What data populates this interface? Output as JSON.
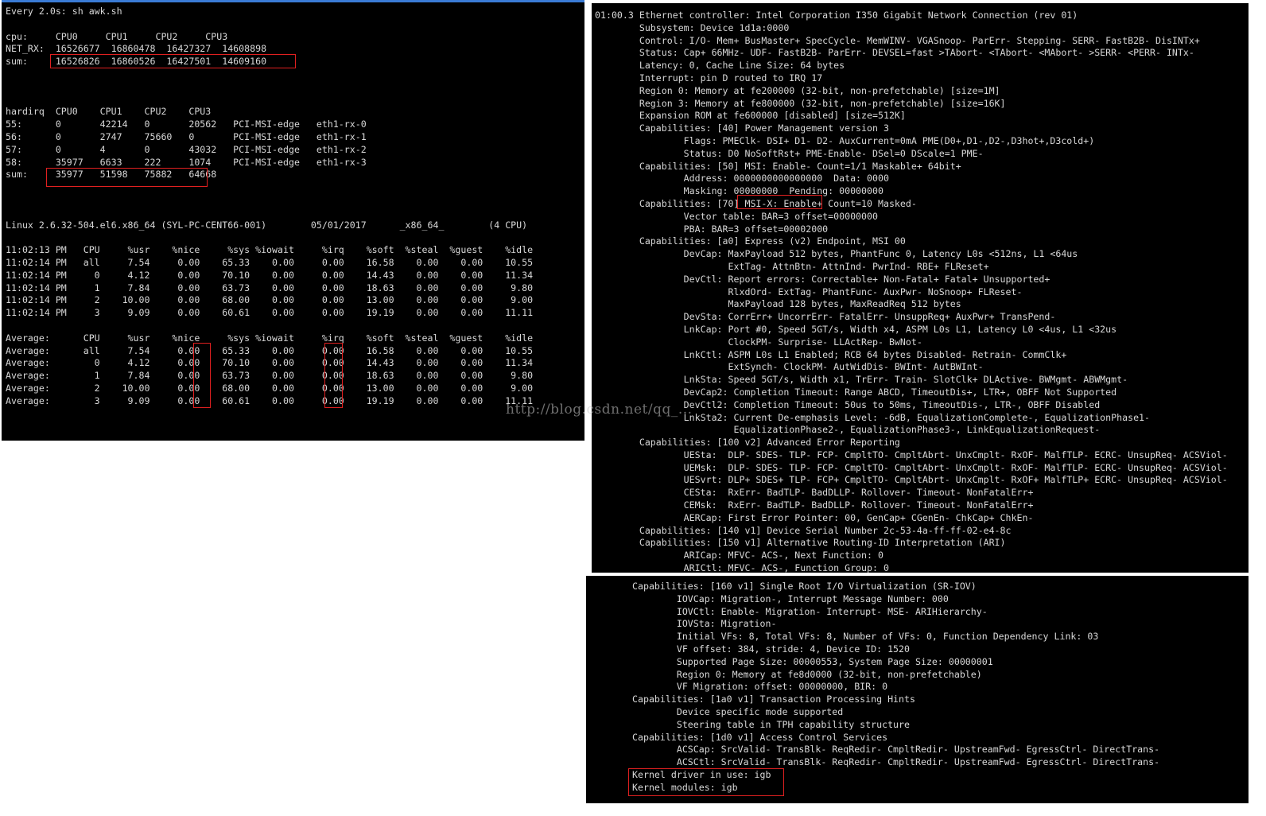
{
  "terminal_left": {
    "lines": [
      "Every 2.0s: sh awk.sh",
      "",
      "cpu:     CPU0     CPU1     CPU2     CPU3",
      "NET_RX:  16526677  16860478  16427327  14608898",
      "sum:     16526826  16860526  16427501  14609160",
      "",
      "",
      "",
      "hardirq  CPU0    CPU1    CPU2    CPU3",
      "55:      0       42214   0       20562   PCI-MSI-edge   eth1-rx-0",
      "56:      0       2747    75660   0       PCI-MSI-edge   eth1-rx-1",
      "57:      0       4       0       43032   PCI-MSI-edge   eth1-rx-2",
      "58:      35977   6633    222     1074    PCI-MSI-edge   eth1-rx-3",
      "sum:     35977   51598   75882   64668",
      "",
      "",
      "",
      "Linux 2.6.32-504.el6.x86_64 (SYL-PC-CENT66-001)        05/01/2017      _x86_64_        (4 CPU)",
      "",
      "11:02:13 PM   CPU     %usr    %nice     %sys %iowait     %irq    %soft  %steal  %guest    %idle",
      "11:02:14 PM   all     7.54     0.00    65.33    0.00     0.00    16.58    0.00    0.00    10.55",
      "11:02:14 PM     0     4.12     0.00    70.10    0.00     0.00    14.43    0.00    0.00    11.34",
      "11:02:14 PM     1     7.84     0.00    63.73    0.00     0.00    18.63    0.00    0.00     9.80",
      "11:02:14 PM     2    10.00     0.00    68.00    0.00     0.00    13.00    0.00    0.00     9.00",
      "11:02:14 PM     3     9.09     0.00    60.61    0.00     0.00    19.19    0.00    0.00    11.11",
      "",
      "Average:      CPU     %usr    %nice     %sys %iowait     %irq    %soft  %steal  %guest    %idle",
      "Average:      all     7.54     0.00    65.33    0.00     0.00    16.58    0.00    0.00    10.55",
      "Average:        0     4.12     0.00    70.10    0.00     0.00    14.43    0.00    0.00    11.34",
      "Average:        1     7.84     0.00    63.73    0.00     0.00    18.63    0.00    0.00     9.80",
      "Average:        2    10.00     0.00    68.00    0.00     0.00    13.00    0.00    0.00     9.00",
      "Average:        3     9.09     0.00    60.61    0.00     0.00    19.19    0.00    0.00    11.11"
    ]
  },
  "terminal_right_top": {
    "lines": [
      "01:00.3 Ethernet controller: Intel Corporation I350 Gigabit Network Connection (rev 01)",
      "        Subsystem: Device 1d1a:0000",
      "        Control: I/O- Mem+ BusMaster+ SpecCycle- MemWINV- VGASnoop- ParErr- Stepping- SERR- FastB2B- DisINTx+",
      "        Status: Cap+ 66MHz- UDF- FastB2B- ParErr- DEVSEL=fast >TAbort- <TAbort- <MAbort- >SERR- <PERR- INTx-",
      "        Latency: 0, Cache Line Size: 64 bytes",
      "        Interrupt: pin D routed to IRQ 17",
      "        Region 0: Memory at fe200000 (32-bit, non-prefetchable) [size=1M]",
      "        Region 3: Memory at fe800000 (32-bit, non-prefetchable) [size=16K]",
      "        Expansion ROM at fe600000 [disabled] [size=512K]",
      "        Capabilities: [40] Power Management version 3",
      "                Flags: PMEClk- DSI+ D1- D2- AuxCurrent=0mA PME(D0+,D1-,D2-,D3hot+,D3cold+)",
      "                Status: D0 NoSoftRst+ PME-Enable- DSel=0 DScale=1 PME-",
      "        Capabilities: [50] MSI: Enable- Count=1/1 Maskable+ 64bit+",
      "                Address: 0000000000000000  Data: 0000",
      "                Masking: 00000000  Pending: 00000000",
      "        Capabilities: [70] MSI-X: Enable+ Count=10 Masked-",
      "                Vector table: BAR=3 offset=00000000",
      "                PBA: BAR=3 offset=00002000",
      "        Capabilities: [a0] Express (v2) Endpoint, MSI 00",
      "                DevCap: MaxPayload 512 bytes, PhantFunc 0, Latency L0s <512ns, L1 <64us",
      "                        ExtTag- AttnBtn- AttnInd- PwrInd- RBE+ FLReset+",
      "                DevCtl: Report errors: Correctable+ Non-Fatal+ Fatal+ Unsupported+",
      "                        RlxdOrd- ExtTag- PhantFunc- AuxPwr- NoSnoop+ FLReset-",
      "                        MaxPayload 128 bytes, MaxReadReq 512 bytes",
      "                DevSta: CorrErr+ UncorrErr- FatalErr- UnsuppReq+ AuxPwr+ TransPend-",
      "                LnkCap: Port #0, Speed 5GT/s, Width x4, ASPM L0s L1, Latency L0 <4us, L1 <32us",
      "                        ClockPM- Surprise- LLActRep- BwNot-",
      "                LnkCtl: ASPM L0s L1 Enabled; RCB 64 bytes Disabled- Retrain- CommClk+",
      "                        ExtSynch- ClockPM- AutWidDis- BWInt- AutBWInt-",
      "                LnkSta: Speed 5GT/s, Width x1, TrErr- Train- SlotClk+ DLActive- BWMgmt- ABWMgmt-",
      "                DevCap2: Completion Timeout: Range ABCD, TimeoutDis+, LTR+, OBFF Not Supported",
      "                DevCtl2: Completion Timeout: 50us to 50ms, TimeoutDis-, LTR-, OBFF Disabled",
      "                LnkSta2: Current De-emphasis Level: -6dB, EqualizationComplete-, EqualizationPhase1-",
      "                         EqualizationPhase2-, EqualizationPhase3-, LinkEqualizationRequest-",
      "        Capabilities: [100 v2] Advanced Error Reporting",
      "                UESta:  DLP- SDES- TLP- FCP- CmpltTO- CmpltAbrt- UnxCmplt- RxOF- MalfTLP- ECRC- UnsupReq- ACSViol-",
      "                UEMsk:  DLP- SDES- TLP- FCP- CmpltTO- CmpltAbrt- UnxCmplt- RxOF- MalfTLP- ECRC- UnsupReq- ACSViol-",
      "                UESvrt: DLP+ SDES+ TLP- FCP+ CmpltTO- CmpltAbrt- UnxCmplt- RxOF+ MalfTLP+ ECRC- UnsupReq- ACSViol-",
      "                CESta:  RxErr- BadTLP- BadDLLP- Rollover- Timeout- NonFatalErr+",
      "                CEMsk:  RxErr- BadTLP- BadDLLP- Rollover- Timeout- NonFatalErr+",
      "                AERCap: First Error Pointer: 00, GenCap+ CGenEn- ChkCap+ ChkEn-",
      "        Capabilities: [140 v1] Device Serial Number 2c-53-4a-ff-ff-02-e4-8c",
      "        Capabilities: [150 v1] Alternative Routing-ID Interpretation (ARI)",
      "                ARICap: MFVC- ACS-, Next Function: 0",
      "                ARICtl: MFVC- ACS-, Function Group: 0"
    ]
  },
  "terminal_right_bottom": {
    "lines": [
      "Capabilities: [160 v1] Single Root I/O Virtualization (SR-IOV)",
      "        IOVCap: Migration-, Interrupt Message Number: 000",
      "        IOVCtl: Enable- Migration- Interrupt- MSE- ARIHierarchy-",
      "        IOVSta: Migration-",
      "        Initial VFs: 8, Total VFs: 8, Number of VFs: 0, Function Dependency Link: 03",
      "        VF offset: 384, stride: 4, Device ID: 1520",
      "        Supported Page Size: 00000553, System Page Size: 00000001",
      "        Region 0: Memory at fe8d0000 (32-bit, non-prefetchable)",
      "        VF Migration: offset: 00000000, BIR: 0",
      "Capabilities: [1a0 v1] Transaction Processing Hints",
      "        Device specific mode supported",
      "        Steering table in TPH capability structure",
      "Capabilities: [1d0 v1] Access Control Services",
      "        ACSCap: SrcValid- TransBlk- ReqRedir- CmpltRedir- UpstreamFwd- EgressCtrl- DirectTrans-",
      "        ACSCtl: SrcValid- TransBlk- ReqRedir- CmpltRedir- UpstreamFwd- EgressCtrl- DirectTrans-",
      "Kernel driver in use: igb",
      "Kernel modules: igb"
    ]
  },
  "watermark": "http://blog.csdn.net/qq_...",
  "colors": {
    "terminal_bg": "#000000",
    "terminal_fg": "#d8d8d8",
    "highlight": "#e02020",
    "tab_accent": "#3a7bd5"
  }
}
